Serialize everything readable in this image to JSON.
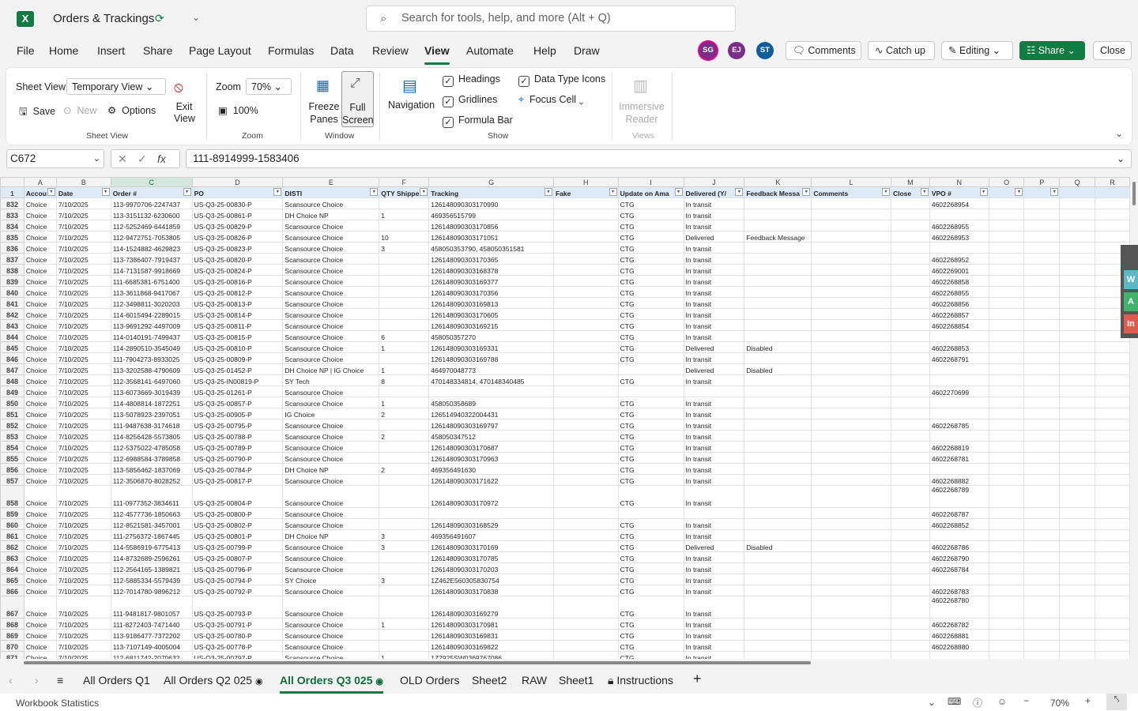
{
  "app": {
    "title": "Orders & Trackings",
    "search_placeholder": "Search for tools, help, and more (Alt + Q)",
    "logo_letter": "X"
  },
  "menu": [
    "File",
    "Home",
    "Insert",
    "Share",
    "Page Layout",
    "Formulas",
    "Data",
    "Review",
    "View",
    "Automate",
    "Help",
    "Draw"
  ],
  "avatars": [
    {
      "initials": "SG",
      "color": "#7a2e8a"
    },
    {
      "initials": "EJ",
      "color": "#7a2e8a"
    },
    {
      "initials": "ST",
      "color": "#0f5c9e"
    }
  ],
  "header_buttons": {
    "comments": "Comments",
    "catchup": "Catch up",
    "editing": "Editing",
    "share": "Share",
    "close": "Close"
  },
  "ribbon": {
    "sheet_view_label": "Sheet View",
    "sheet_view_value": "Temporary View",
    "save": "Save",
    "new": "New",
    "options": "Options",
    "exit_view": "Exit View",
    "group_sheet_view": "Sheet View",
    "zoom_label": "Zoom",
    "zoom_value": "70%",
    "zoom_100": "100%",
    "group_zoom": "Zoom",
    "freeze_panes": "Freeze Panes",
    "full_screen": "Full Screen",
    "group_window": "Window",
    "navigation": "Navigation",
    "headings": "Headings",
    "gridlines": "Gridlines",
    "formula_bar": "Formula Bar",
    "data_type_icons": "Data Type Icons",
    "focus_cell": "Focus Cell",
    "group_show": "Show",
    "immersive_reader": "Immersive Reader",
    "group_views": "Views"
  },
  "formula_bar": {
    "name_box": "C672",
    "formula": "111-8914999-1583406"
  },
  "columns": [
    "A",
    "B",
    "C",
    "D",
    "E",
    "F",
    "G",
    "H",
    "I",
    "J",
    "K",
    "L",
    "M",
    "N",
    "O",
    "P",
    "Q",
    "R"
  ],
  "header_row_number": "1",
  "header_row": [
    "Accou",
    "Date",
    "Order #",
    "PO",
    "DISTI",
    "QTY Shippe",
    "Tracking",
    "Fake",
    "Update on Ama",
    "Delivered (Y/",
    "Feedback Messa",
    "Comments",
    "Close",
    "VPO #",
    "",
    "",
    "",
    ""
  ],
  "rows": [
    [
      "832",
      "Choice",
      "7/10/2025",
      "113-9970706-2247437",
      "US-Q3-25-00830-P",
      "Scansource Choice",
      "",
      "126148090303170990",
      "",
      "CTG",
      "In transit",
      "",
      "",
      "",
      "4602268954"
    ],
    [
      "833",
      "Choice",
      "7/10/2025",
      "113-3151132-6230600",
      "US-Q3-25-00861-P",
      "DH Choice NP",
      "1",
      "469356515799",
      "",
      "CTG",
      "In transit",
      "",
      "",
      "",
      ""
    ],
    [
      "834",
      "Choice",
      "7/10/2025",
      "112-5252469-6441859",
      "US-Q3-25-00829-P",
      "Scansource Choice",
      "",
      "126148090303170856",
      "",
      "CTG",
      "In transit",
      "",
      "",
      "",
      "4602268955"
    ],
    [
      "835",
      "Choice",
      "7/10/2025",
      "112-9472751-7053805",
      "US-Q3-25-00826-P",
      "Scansource Choice",
      "10",
      "126148090303171051",
      "",
      "CTG",
      "Delivered",
      "Feedback Message",
      "",
      "",
      "4602268953"
    ],
    [
      "836",
      "Choice",
      "7/10/2025",
      "114-1524882-4629823",
      "US-Q3-25-00823-P",
      "Scansource Choice",
      "3",
      "458050353790, 458050351581",
      "",
      "CTG",
      "In transit",
      "",
      "",
      "",
      ""
    ],
    [
      "837",
      "Choice",
      "7/10/2025",
      "113-7386407-7919437",
      "US-Q3-25-00820-P",
      "Scansource Choice",
      "",
      "126148090303170365",
      "",
      "CTG",
      "In transit",
      "",
      "",
      "",
      "4602268952"
    ],
    [
      "838",
      "Choice",
      "7/10/2025",
      "114-7131587-9918669",
      "US-Q3-25-00824-P",
      "Scansource Choice",
      "",
      "126148090303168378",
      "",
      "CTG",
      "In transit",
      "",
      "",
      "",
      "4602269001"
    ],
    [
      "839",
      "Choice",
      "7/10/2025",
      "111-6685381-6751400",
      "US-Q3-25-00816-P",
      "Scansource Choice",
      "",
      "126148090303169377",
      "",
      "CTG",
      "In transit",
      "",
      "",
      "",
      "4602268858"
    ],
    [
      "840",
      "Choice",
      "7/10/2025",
      "113-3611868-9417067",
      "US-Q3-25-00812-P",
      "Scansource Choice",
      "",
      "126148090303170356",
      "",
      "CTG",
      "In transit",
      "",
      "",
      "",
      "4602268855"
    ],
    [
      "841",
      "Choice",
      "7/10/2025",
      "112-3498811-3020203",
      "US-Q3-25-00813-P",
      "Scansource Choice",
      "",
      "126148090303169813",
      "",
      "CTG",
      "In transit",
      "",
      "",
      "",
      "4602268856"
    ],
    [
      "842",
      "Choice",
      "7/10/2025",
      "114-6015494-2289015",
      "US-Q3-25-00814-P",
      "Scansource Choice",
      "",
      "126148090303170605",
      "",
      "CTG",
      "In transit",
      "",
      "",
      "",
      "4602268857"
    ],
    [
      "843",
      "Choice",
      "7/10/2025",
      "113-9691292-4497009",
      "US-Q3-25-00811-P",
      "Scansource Choice",
      "",
      "126148090303169215",
      "",
      "CTG",
      "In transit",
      "",
      "",
      "",
      "4602268854"
    ],
    [
      "844",
      "Choice",
      "7/10/2025",
      "114-0140191-7499437",
      "US-Q3-25-00815-P",
      "Scansource Choice",
      "6",
      "458050357270",
      "",
      "CTG",
      "In transit",
      "",
      "",
      "",
      ""
    ],
    [
      "845",
      "Choice",
      "7/10/2025",
      "114-2890510-3545049",
      "US-Q3-25-00810-P",
      "Scansource Choice",
      "1",
      "126148090303169331",
      "",
      "CTG",
      "Delivered",
      "Disabled",
      "",
      "",
      "4602268853"
    ],
    [
      "846",
      "Choice",
      "7/10/2025",
      "111-7904273-8933025",
      "US-Q3-25-00809-P",
      "Scansource Choice",
      "",
      "126148090303169788",
      "",
      "CTG",
      "In transit",
      "",
      "",
      "",
      "4602268791"
    ],
    [
      "847",
      "Choice",
      "7/10/2025",
      "113-3202588-4790609",
      "US-Q3-25-01452-P",
      "DH Choice NP | IG Choice",
      "1",
      "464970048773",
      "",
      "",
      "Delivered",
      "Disabled",
      "",
      "",
      ""
    ],
    [
      "848",
      "Choice",
      "7/10/2025",
      "112-3568141-6497060",
      "US-Q3-25-IN00819-P",
      "SY Tech",
      "8",
      "470148334814, 470148340485",
      "",
      "CTG",
      "In transit",
      "",
      "",
      "",
      ""
    ],
    [
      "849",
      "Choice",
      "7/10/2025",
      "113-6073669-3019439",
      "US-Q3-25-01261-P",
      "Scansource Choice",
      "",
      "",
      "",
      "",
      "",
      "",
      "",
      "",
      "4602270699"
    ],
    [
      "850",
      "Choice",
      "7/10/2025",
      "114-4808814-1872251",
      "US-Q3-25-00857-P",
      "Scansource Choice",
      "1",
      "458050358689",
      "",
      "CTG",
      "In transit",
      "",
      "",
      "",
      ""
    ],
    [
      "851",
      "Choice",
      "7/10/2025",
      "113-5078923-2397051",
      "US-Q3-25-00905-P",
      "IG Choice",
      "2",
      "126514940322004431",
      "",
      "CTG",
      "In transit",
      "",
      "",
      "",
      ""
    ],
    [
      "852",
      "Choice",
      "7/10/2025",
      "111-9487638-3174618",
      "US-Q3-25-00795-P",
      "Scansource Choice",
      "",
      "126148090303169797",
      "",
      "CTG",
      "In transit",
      "",
      "",
      "",
      "4602268785"
    ],
    [
      "853",
      "Choice",
      "7/10/2025",
      "114-8256428-5573805",
      "US-Q3-25-00788-P",
      "Scansource Choice",
      "2",
      "458050347512",
      "",
      "CTG",
      "In transit",
      "",
      "",
      "",
      ""
    ],
    [
      "854",
      "Choice",
      "7/10/2025",
      "112-5375022-4785058",
      "US-Q3-25-00789-P",
      "Scansource Choice",
      "",
      "126148090303170687",
      "",
      "CTG",
      "In transit",
      "",
      "",
      "",
      "4602268819"
    ],
    [
      "855",
      "Choice",
      "7/10/2025",
      "112-6988584-3789858",
      "US-Q3-25-00790-P",
      "Scansource Choice",
      "",
      "126148090303170963",
      "",
      "CTG",
      "In transit",
      "",
      "",
      "",
      "4602268781"
    ],
    [
      "856",
      "Choice",
      "7/10/2025",
      "113-5856462-1837069",
      "US-Q3-25-00784-P",
      "DH Choice NP",
      "2",
      "469356491630",
      "",
      "CTG",
      "In transit",
      "",
      "",
      "",
      ""
    ],
    [
      "857",
      "Choice",
      "7/10/2025",
      "112-3506870-8028252",
      "US-Q3-25-00817-P",
      "Scansource Choice",
      "",
      "126148090303171622",
      "",
      "CTG",
      "In transit",
      "",
      "",
      "",
      "4602268882"
    ],
    [
      "858",
      "Choice",
      "7/10/2025",
      "111-0977352-3834611",
      "US-Q3-25-00804-P",
      "Scansource Choice",
      "",
      "126148090303170972",
      "",
      "CTG",
      "In transit",
      "",
      "",
      "",
      "4602268789"
    ],
    [
      "859",
      "Choice",
      "7/10/2025",
      "112-4577736-1850663",
      "US-Q3-25-00800-P",
      "Scansource Choice",
      "",
      "",
      "",
      "",
      "",
      "",
      "",
      "",
      "4602268787"
    ],
    [
      "860",
      "Choice",
      "7/10/2025",
      "112-8521581-3457001",
      "US-Q3-25-00802-P",
      "Scansource Choice",
      "",
      "126148090303168529",
      "",
      "CTG",
      "In transit",
      "",
      "",
      "",
      "4602268852"
    ],
    [
      "861",
      "Choice",
      "7/10/2025",
      "111-2756372-1867445",
      "US-Q3-25-00801-P",
      "DH Choice NP",
      "3",
      "469356491607",
      "",
      "CTG",
      "In transit",
      "",
      "",
      "",
      ""
    ],
    [
      "862",
      "Choice",
      "7/10/2025",
      "114-5586919-6775413",
      "US-Q3-25-00799-P",
      "Scansource Choice",
      "3",
      "126148090303170169",
      "",
      "CTG",
      "Delivered",
      "Disabled",
      "",
      "",
      "4602268786"
    ],
    [
      "863",
      "Choice",
      "7/10/2025",
      "114-8732689-2596261",
      "US-Q3-25-00807-P",
      "Scansource Choice",
      "",
      "126148090303170785",
      "",
      "CTG",
      "In transit",
      "",
      "",
      "",
      "4602268790"
    ],
    [
      "864",
      "Choice",
      "7/10/2025",
      "112-2564165-1389821",
      "US-Q3-25-00796-P",
      "Scansource Choice",
      "",
      "126148090303170203",
      "",
      "CTG",
      "In transit",
      "",
      "",
      "",
      "4602268784"
    ],
    [
      "865",
      "Choice",
      "7/10/2025",
      "112-5885334-5579439",
      "US-Q3-25-00794-P",
      "SY Choice",
      "3",
      "1Z462E560305830754",
      "",
      "CTG",
      "In transit",
      "",
      "",
      "",
      ""
    ],
    [
      "866",
      "Choice",
      "7/10/2025",
      "112-7014780-9896212",
      "US-Q3-25-00792-P",
      "Scansource Choice",
      "",
      "126148090303170838",
      "",
      "CTG",
      "In transit",
      "",
      "",
      "",
      "4602268783"
    ],
    [
      "867",
      "Choice",
      "7/10/2025",
      "111-9481817-9801057",
      "US-Q3-25-00793-P",
      "Scansource Choice",
      "",
      "126148090303169279",
      "",
      "CTG",
      "In transit",
      "",
      "",
      "",
      "4602268780"
    ],
    [
      "868",
      "Choice",
      "7/10/2025",
      "111-8272403-7471440",
      "US-Q3-25-00791-P",
      "Scansource Choice",
      "1",
      "126148090303170981",
      "",
      "CTG",
      "In transit",
      "",
      "",
      "",
      "4602268782"
    ],
    [
      "869",
      "Choice",
      "7/10/2025",
      "113-9186477-7372202",
      "US-Q3-25-00780-P",
      "Scansource Choice",
      "",
      "126148090303169831",
      "",
      "CTG",
      "In transit",
      "",
      "",
      "",
      "4602268881"
    ],
    [
      "870",
      "Choice",
      "7/10/2025",
      "113-7107149-4005004",
      "US-Q3-25-00778-P",
      "Scansource Choice",
      "",
      "126148090303169822",
      "",
      "CTG",
      "In transit",
      "",
      "",
      "",
      "4602268880"
    ],
    [
      "871",
      "Choice",
      "7/10/2025",
      "112-6811742-2070632",
      "US-Q3-25-00797-P",
      "Scansource Choice",
      "1",
      "1Z7925SW0369767086",
      "",
      "CTG",
      "In transit",
      "",
      "",
      "",
      ""
    ]
  ],
  "side_panel": [
    "W",
    "A",
    "In"
  ],
  "sheet_tabs": [
    "All Orders Q1",
    "All Orders Q2 025",
    "All Orders Q3 025",
    "OLD Orders",
    "Sheet2",
    "RAW",
    "Sheet1",
    "Instructions"
  ],
  "active_sheet": "All Orders Q3 025",
  "status": {
    "left": "Workbook Statistics",
    "zoom": "70%"
  }
}
